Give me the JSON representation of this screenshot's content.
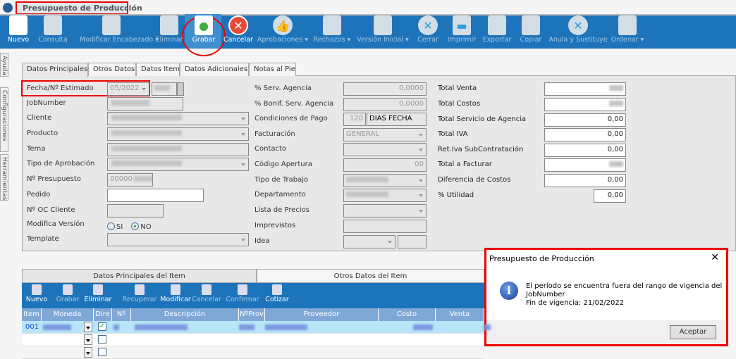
{
  "window": {
    "title": "Presupuesto de Producción"
  },
  "toolbar": [
    {
      "label": "Nuevo",
      "icon": "new-document-icon",
      "enabled": true
    },
    {
      "label": "Consulta",
      "icon": "query-document-icon",
      "enabled": false
    },
    {
      "label": "Modificar Encabezado ▾",
      "icon": "edit-document-icon",
      "enabled": false
    },
    {
      "label": "Eliminar",
      "icon": "delete-document-icon",
      "enabled": false
    },
    {
      "label": "Grabar",
      "icon": "save-icon",
      "enabled": true
    },
    {
      "label": "Cancelar",
      "icon": "cancel-icon",
      "enabled": true
    },
    {
      "label": "Aprobaciones ▾",
      "icon": "thumbs-up-icon",
      "enabled": false
    },
    {
      "label": "Rechazos ▾",
      "icon": "reject-icon",
      "enabled": false
    },
    {
      "label": "Versión Inicial ▾",
      "icon": "initial-version-icon",
      "enabled": false
    },
    {
      "label": "Cerrar",
      "icon": "close-icon",
      "enabled": false
    },
    {
      "label": "Imprimir",
      "icon": "printer-icon",
      "enabled": false
    },
    {
      "label": "Exportar",
      "icon": "export-icon",
      "enabled": false
    },
    {
      "label": "Copiar",
      "icon": "copy-icon",
      "enabled": false
    },
    {
      "label": "Anula y Sustituye",
      "icon": "void-replace-icon",
      "enabled": false
    },
    {
      "label": "Ordenar ▾",
      "icon": "order-icon",
      "enabled": false
    }
  ],
  "side_tabs": [
    "Ayuda",
    "Configuraciones",
    "Herramientas"
  ],
  "tabs": [
    "Datos Principales",
    "Otros Datos",
    "Datos Item",
    "Datos Adicionales",
    "Notas al Pie"
  ],
  "left_fields": [
    {
      "label": "Fecha/Nº Estimado",
      "value": "05/2022"
    },
    {
      "label": "JobNumber"
    },
    {
      "label": "Cliente"
    },
    {
      "label": "Producto"
    },
    {
      "label": "Tema"
    },
    {
      "label": "Tipo de Aprobación"
    },
    {
      "label": "Nº Presupuesto",
      "value": "00000"
    },
    {
      "label": "Pedido"
    },
    {
      "label": "Nº OC Cliente"
    },
    {
      "label": "Modifica Versión"
    },
    {
      "label": "Template"
    }
  ],
  "modifica_version": {
    "options": [
      "SI",
      "NO"
    ],
    "selected": "NO"
  },
  "mid_fields": [
    {
      "label": "% Serv. Agencia",
      "value": "0,0000"
    },
    {
      "label": "% Bonif. Serv. Agencia",
      "value": "0,0000"
    },
    {
      "label": "Condiciones de Pago",
      "value": "120",
      "value2": "DIAS FECHA"
    },
    {
      "label": "Facturación",
      "value": "GENERAL"
    },
    {
      "label": "Contacto"
    },
    {
      "label": "Código Apertura",
      "value": "00"
    },
    {
      "label": "Tipo de Trabajo"
    },
    {
      "label": "Departamento"
    },
    {
      "label": "Lista de Precios"
    },
    {
      "label": "Imprevistos"
    },
    {
      "label": "Idea"
    }
  ],
  "totals": [
    {
      "label": "Total Venta"
    },
    {
      "label": "Total Costos"
    },
    {
      "label": "Total Servicio de Agencia",
      "value": "0,00"
    },
    {
      "label": "Total IVA",
      "value": "0,00"
    },
    {
      "label": "Ret.Iva SubContratación",
      "value": "0,00"
    },
    {
      "label": "Total a Facturar"
    },
    {
      "label": "Diferencia de Costos",
      "value": "0,00"
    },
    {
      "label": "% Utilidad",
      "value": "0,00"
    }
  ],
  "item_tabs": [
    "Datos Principales del Item",
    "Otros Datos del Item"
  ],
  "item_toolbar": [
    {
      "label": "Nuevo",
      "enabled": true
    },
    {
      "label": "Grabar",
      "enabled": false
    },
    {
      "label": "Eliminar",
      "enabled": true
    },
    {
      "label": "Recuperar",
      "enabled": false
    },
    {
      "label": "Modificar",
      "enabled": true
    },
    {
      "label": "Cancelar",
      "enabled": false
    },
    {
      "label": "Confirmar",
      "enabled": false
    },
    {
      "label": "Cotizar",
      "enabled": true
    }
  ],
  "grid": {
    "columns": [
      "Item",
      "Moneda",
      "Dire",
      "Nº",
      "Descripción",
      "NºProv",
      "Proveedor",
      "Costo",
      "Venta"
    ],
    "rows": [
      {
        "item": "001",
        "dire": true
      },
      {
        "item": "",
        "dire": false
      },
      {
        "item": "",
        "dire": false
      }
    ]
  },
  "dialog": {
    "title": "Presupuesto de Producción",
    "line1": "El período se encuentra fuera del rango de vigencia del",
    "line2": "JobNumber",
    "line3": "Fin de vigencia: 21/02/2022",
    "ok": "Aceptar",
    "icon": "info-icon"
  },
  "colors": {
    "toolbar": "#1e74ba",
    "highlight": "#e00000"
  }
}
